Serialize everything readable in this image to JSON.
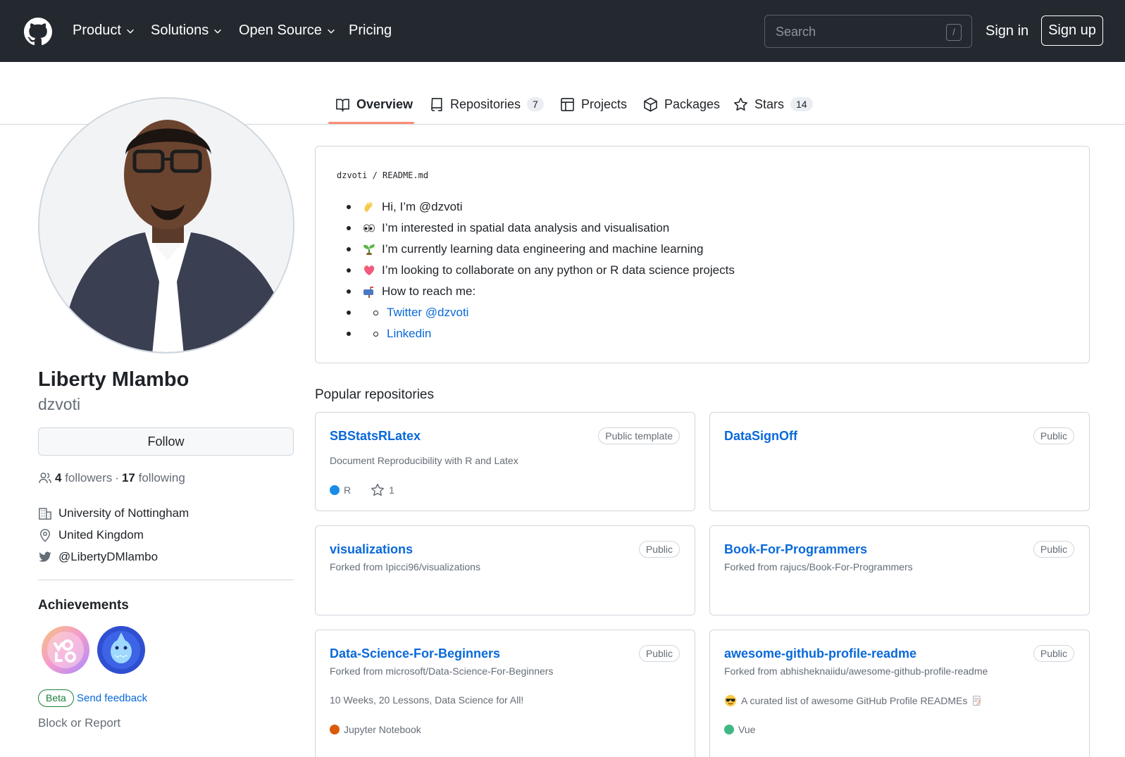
{
  "header": {
    "nav": [
      "Product",
      "Solutions",
      "Open Source",
      "Pricing"
    ],
    "search_placeholder": "Search",
    "search_key": "/",
    "sign_in": "Sign in",
    "sign_up": "Sign up"
  },
  "tabs": [
    {
      "label": "Overview"
    },
    {
      "label": "Repositories",
      "count": "7"
    },
    {
      "label": "Projects"
    },
    {
      "label": "Packages"
    },
    {
      "label": "Stars",
      "count": "14"
    }
  ],
  "profile": {
    "name": "Liberty Mlambo",
    "username": "dzvoti",
    "follow_label": "Follow",
    "followers_count": "4",
    "followers_label": "followers",
    "separator": "·",
    "following_count": "17",
    "following_label": "following",
    "organization": "University of Nottingham",
    "location": "United Kingdom",
    "twitter": "@LibertyDMlambo",
    "achievements_title": "Achievements",
    "beta_label": "Beta",
    "feedback_label": "Send feedback",
    "block_label": "Block or Report"
  },
  "readme": {
    "path_user": "dzvoti",
    "path_sep": " / ",
    "path_file": "README.md",
    "items": [
      "Hi, I’m @dzvoti",
      "I’m interested in spatial data analysis and visualisation",
      "I’m currently learning data engineering and machine learning",
      "I’m looking to collaborate on any python or R data science projects",
      "How to reach me:"
    ],
    "links": [
      "Twitter @dzvoti",
      "Linkedin"
    ]
  },
  "popular": {
    "title": "Popular repositories",
    "repos": [
      {
        "name": "SBStatsRLatex",
        "visibility": "Public template",
        "description": "Document Reproducibility with R and Latex",
        "language": "R",
        "lang_color": "#198ce7",
        "stars": "1"
      },
      {
        "name": "DataSignOff",
        "visibility": "Public"
      },
      {
        "name": "visualizations",
        "visibility": "Public",
        "forked_from": "Forked from Ipicci96/visualizations"
      },
      {
        "name": "Book-For-Programmers",
        "visibility": "Public",
        "forked_from": "Forked from rajucs/Book-For-Programmers"
      },
      {
        "name": "Data-Science-For-Beginners",
        "visibility": "Public",
        "forked_from": "Forked from microsoft/Data-Science-For-Beginners",
        "description": "10 Weeks, 20 Lessons, Data Science for All!",
        "language": "Jupyter Notebook",
        "lang_color": "#DA5B0B"
      },
      {
        "name": "awesome-github-profile-readme",
        "visibility": "Public",
        "forked_from": "Forked from abhisheknaiidu/awesome-github-profile-readme",
        "description": "A curated list of awesome GitHub Profile READMEs",
        "language": "Vue",
        "lang_color": "#41b883"
      }
    ]
  },
  "colors": {
    "header_bg": "#24292f",
    "link": "#0969da",
    "tab_underline": "#fd8c73"
  }
}
